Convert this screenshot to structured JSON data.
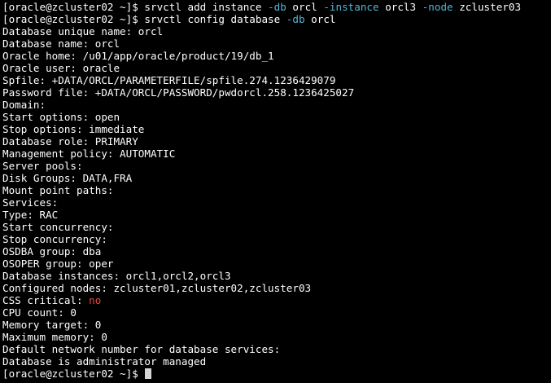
{
  "prompt": "[oracle@zcluster02 ~]$",
  "commands": {
    "add_instance": {
      "cmd": "srvctl add instance",
      "db_flag": "-db",
      "db_value": "orcl",
      "instance_flag": "-instance",
      "instance_value": "orcl3",
      "node_flag": "-node",
      "node_value": "zcluster03"
    },
    "config_database": {
      "cmd": "srvctl config database",
      "db_flag": "-db",
      "db_value": "orcl"
    }
  },
  "output": [
    "Database unique name: orcl",
    "Database name: orcl",
    "Oracle home: /u01/app/oracle/product/19/db_1",
    "Oracle user: oracle",
    "Spfile: +DATA/ORCL/PARAMETERFILE/spfile.274.1236429079",
    "Password file: +DATA/ORCL/PASSWORD/pwdorcl.258.1236425027",
    "Domain:",
    "Start options: open",
    "Stop options: immediate",
    "Database role: PRIMARY",
    "Management policy: AUTOMATIC",
    "Server pools:",
    "Disk Groups: DATA,FRA",
    "Mount point paths:",
    "Services:",
    "Type: RAC",
    "Start concurrency:",
    "Stop concurrency:",
    "OSDBA group: dba",
    "OSOPER group: oper",
    "Database instances: orcl1,orcl2,orcl3",
    "Configured nodes: zcluster01,zcluster02,zcluster03"
  ],
  "css_critical": {
    "label": "CSS critical:",
    "value": "no"
  },
  "output_tail": [
    "CPU count: 0",
    "Memory target: 0",
    "Maximum memory: 0",
    "Default network number for database services:",
    "Database is administrator managed"
  ],
  "colors": {
    "background": "#000000",
    "foreground": "#ffffff",
    "option_flag": "#4fb7d6",
    "negative_value": "#e8463c"
  }
}
